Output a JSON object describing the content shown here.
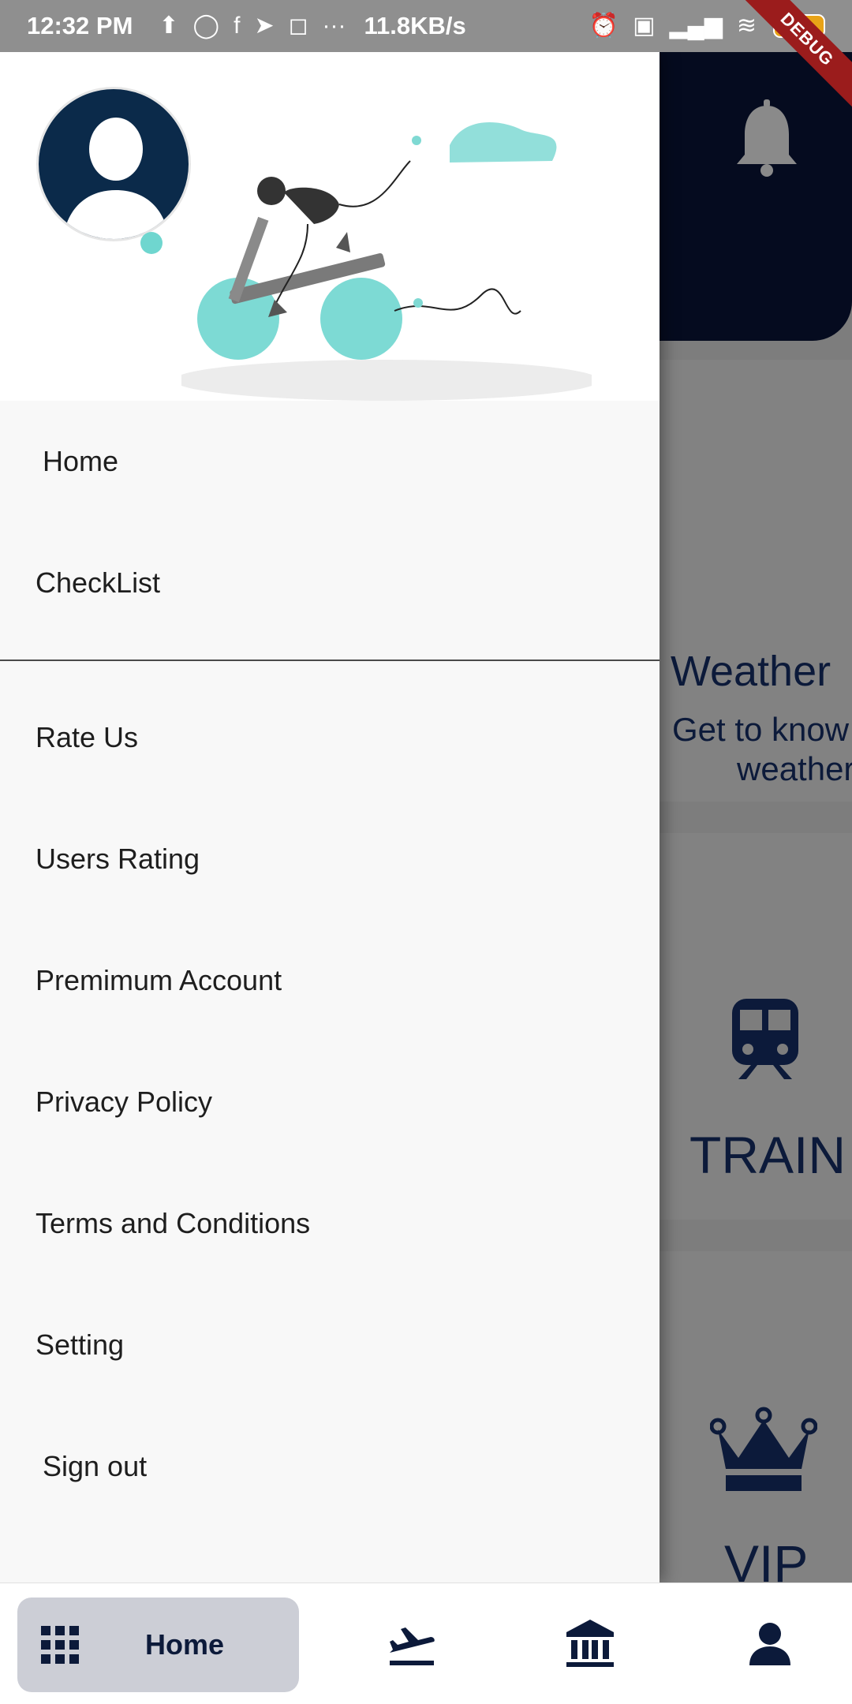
{
  "status_bar": {
    "time": "12:32 PM",
    "network_speed": "11.8KB/s",
    "battery_level": "90",
    "debug_label": "DEBUG",
    "icons": [
      "upload-icon",
      "signal-app-icon",
      "facebook-icon",
      "telegram-icon",
      "instagram-icon",
      "more-icon",
      "alarm-icon",
      "volte-icon",
      "signal-4g-icon",
      "wifi-icon",
      "battery-icon"
    ]
  },
  "drawer": {
    "menu_items": [
      {
        "label": "Home"
      },
      {
        "label": "CheckList"
      }
    ],
    "menu_items_secondary": [
      {
        "label": "Rate Us"
      },
      {
        "label": "Users Rating"
      },
      {
        "label": "Premimum Account"
      },
      {
        "label": "Privacy Policy"
      },
      {
        "label": "Terms and Conditions"
      },
      {
        "label": "Setting"
      },
      {
        "label": "Sign out"
      }
    ]
  },
  "background": {
    "weather_title": "Weather",
    "weather_sub_line1": "Get to know",
    "weather_sub_line2": "weather",
    "train_label": "TRAIN",
    "vip_label": "VIP"
  },
  "bottom_nav": {
    "home_label": "Home",
    "items": [
      "home-grid-icon",
      "flight-icon",
      "bank-icon",
      "profile-icon"
    ]
  },
  "colors": {
    "navy": "#0c1a3a",
    "teal": "#6fd6cf",
    "debug_red": "#9b1c1c",
    "nav_selected_bg": "#ccced6"
  }
}
